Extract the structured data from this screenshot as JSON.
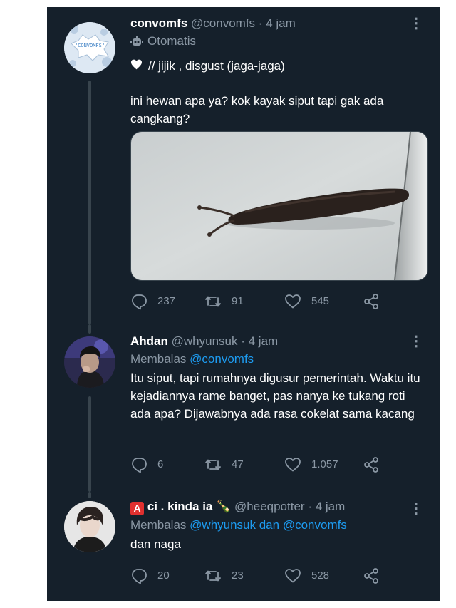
{
  "tweets": [
    {
      "name": "convomfs",
      "handle": "@convomfs",
      "separator": "·",
      "time": "4 jam",
      "avatar_text": "\"CONVOMFS\"",
      "label": "Otomatis",
      "line1_icon": "white-heart-icon",
      "line1": "// jijik , disgust (jaga-jaga)",
      "text": "ini hewan apa ya? kok kayak siput tapi gak ada cangkang?",
      "media_alt": "slug",
      "replies": "237",
      "retweets": "91",
      "likes": "545"
    },
    {
      "name": "Ahdan",
      "handle": "@whyunsuk",
      "separator": "·",
      "time": "4 jam",
      "reply_prefix": "Membalas",
      "reply_to": "@convomfs",
      "text": "Itu siput, tapi rumahnya digusur pemerintah. Waktu itu kejadiannya rame banget, pas nanya ke tukang roti ada apa? Dijawabnya ada rasa cokelat sama kacang",
      "replies": "6",
      "retweets": "47",
      "likes": "1.057"
    },
    {
      "name_badge": "A",
      "name": "ci . kinda ia",
      "name_emoji": "🍾",
      "handle": "@heeqpotter",
      "separator": "·",
      "time": "4 jam",
      "reply_prefix": "Membalas",
      "reply_to": "@whyunsuk dan @convomfs",
      "text": "dan naga",
      "replies": "20",
      "retweets": "23",
      "likes": "528"
    }
  ],
  "more_icon": "⋮",
  "icons": [
    "reply-icon",
    "retweet-icon",
    "like-icon",
    "share-icon",
    "bot-icon"
  ],
  "colors": {
    "background": "#15202b",
    "secondary_text": "#8b98a5",
    "link": "#1d9bf0"
  }
}
